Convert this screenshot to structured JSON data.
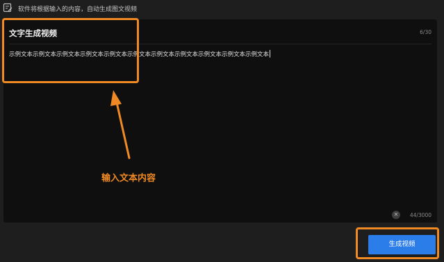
{
  "hint": {
    "icon": "edit-note-icon",
    "text": "软件将根据输入的内容，自动生成图文视频"
  },
  "editor": {
    "title_value": "文字生成视频",
    "title_count": "6/30",
    "content_value": "示例文本示例文本示例文本示例文本示例文本示例文本示例文本示例文本示例文本示例文本示例文本",
    "content_count": "44/3000",
    "clear_icon": "clear-circle-icon"
  },
  "annotation": {
    "text": "输入文本内容",
    "color": "#f08a24"
  },
  "actions": {
    "generate_label": "生成视频",
    "accent": "#2b7de9"
  }
}
